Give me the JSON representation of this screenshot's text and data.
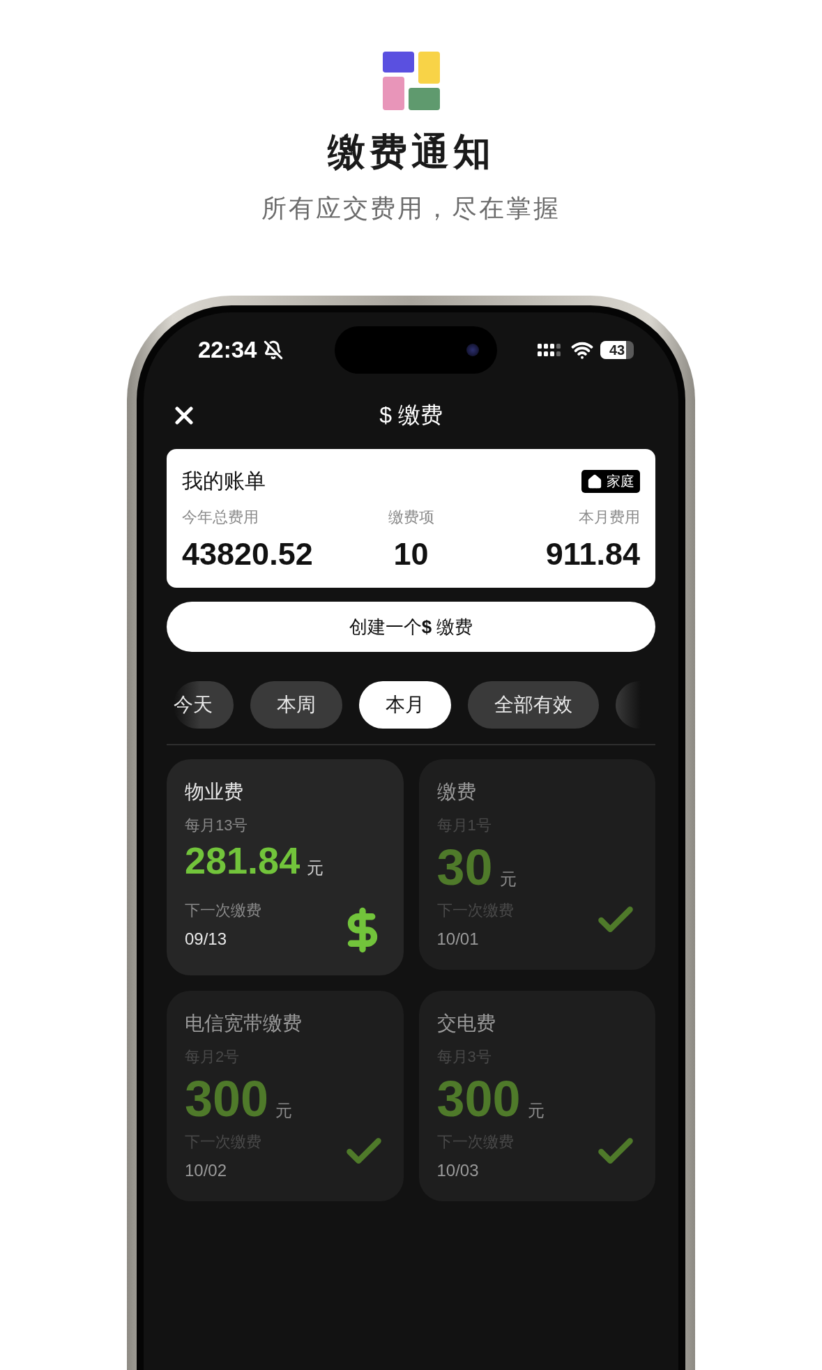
{
  "header": {
    "title": "缴费通知",
    "subtitle": "所有应交费用，尽在掌握"
  },
  "status_bar": {
    "time": "22:34",
    "battery": "43"
  },
  "nav": {
    "symbol": "$",
    "title": "缴费"
  },
  "bill": {
    "title": "我的账单",
    "badge": "家庭",
    "stats": [
      {
        "label": "今年总费用",
        "value": "43820.52"
      },
      {
        "label": "缴费项",
        "value": "10"
      },
      {
        "label": "本月费用",
        "value": "911.84"
      }
    ]
  },
  "create_button": {
    "before": "创建一个",
    "symbol": "$",
    "after": "缴费"
  },
  "filters": [
    {
      "label": "今天",
      "selected": false
    },
    {
      "label": "本周",
      "selected": false
    },
    {
      "label": "本月",
      "selected": true
    },
    {
      "label": "全部有效",
      "selected": false
    }
  ],
  "payments": [
    {
      "name": "物业费",
      "schedule": "每月13号",
      "amount": "281.84",
      "unit": "元",
      "next_label": "下一次缴费",
      "next_date": "09/13",
      "paid": false
    },
    {
      "name": "缴费",
      "schedule": "每月1号",
      "amount": "30",
      "unit": "元",
      "next_label": "下一次缴费",
      "next_date": "10/01",
      "paid": true
    },
    {
      "name": "电信宽带缴费",
      "schedule": "每月2号",
      "amount": "300",
      "unit": "元",
      "next_label": "下一次缴费",
      "next_date": "10/02",
      "paid": true
    },
    {
      "name": "交电费",
      "schedule": "每月3号",
      "amount": "300",
      "unit": "元",
      "next_label": "下一次缴费",
      "next_date": "10/03",
      "paid": true
    }
  ]
}
